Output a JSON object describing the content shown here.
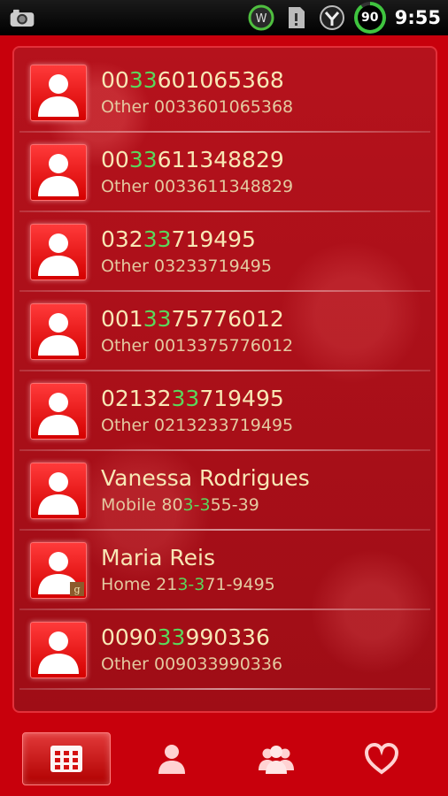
{
  "status_bar": {
    "left_icons": [
      "camera-icon"
    ],
    "right_icons": [
      "sync-icon",
      "sim-icon",
      "signal-icon"
    ],
    "battery": "90",
    "time": "9:55"
  },
  "colors": {
    "background": "#c8000c",
    "name_text": "#f8e7b5",
    "sub_text": "#e4c9a0",
    "highlight": "#5bd75b"
  },
  "contacts": [
    {
      "name_pre": "00",
      "name_hl": "33",
      "name_post": "601065368",
      "sub_pre": "Other 0033601065368",
      "sub_hl": "",
      "sub_post": "",
      "google": false
    },
    {
      "name_pre": "00",
      "name_hl": "33",
      "name_post": "611348829",
      "sub_pre": "Other 0033611348829",
      "sub_hl": "",
      "sub_post": "",
      "google": false
    },
    {
      "name_pre": "032",
      "name_hl": "33",
      "name_post": "719495",
      "sub_pre": "Other 03233719495",
      "sub_hl": "",
      "sub_post": "",
      "google": false
    },
    {
      "name_pre": "001",
      "name_hl": "33",
      "name_post": "75776012",
      "sub_pre": "Other 0013375776012",
      "sub_hl": "",
      "sub_post": "",
      "google": false
    },
    {
      "name_pre": "02132",
      "name_hl": "33",
      "name_post": "719495",
      "sub_pre": "Other 0213233719495",
      "sub_hl": "",
      "sub_post": "",
      "google": false
    },
    {
      "name_pre": "Vanessa Rodrigues",
      "name_hl": "",
      "name_post": "",
      "sub_pre": "Mobile 80",
      "sub_hl": "3-3",
      "sub_post": "55-39",
      "google": false
    },
    {
      "name_pre": "Maria Reis",
      "name_hl": "",
      "name_post": "",
      "sub_pre": "Home 21",
      "sub_hl": "3-3",
      "sub_post": "71-9495",
      "google": true,
      "badge": "g"
    },
    {
      "name_pre": "0090",
      "name_hl": "33",
      "name_post": "990336",
      "sub_pre": "Other 009033990336",
      "sub_hl": "",
      "sub_post": "",
      "google": false
    }
  ],
  "bottom_nav": [
    {
      "icon": "dialpad-icon",
      "active": true
    },
    {
      "icon": "contact-icon",
      "active": false
    },
    {
      "icon": "groups-icon",
      "active": false
    },
    {
      "icon": "favorites-heart-icon",
      "active": false
    }
  ]
}
